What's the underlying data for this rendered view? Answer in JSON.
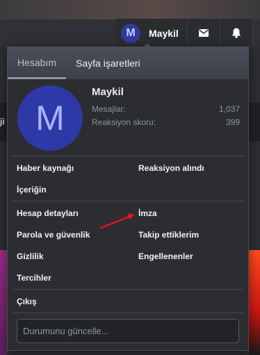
{
  "header": {
    "user_initial": "M",
    "username": "Maykil",
    "mail_icon": "envelope-icon",
    "bell_icon": "bell-icon"
  },
  "background": {
    "strip_text": "ji"
  },
  "dropdown": {
    "tabs": [
      {
        "label": "Hesabım",
        "active": true
      },
      {
        "label": "Sayfa işaretleri",
        "active": false
      }
    ],
    "profile": {
      "initial": "M",
      "name": "Maykil",
      "stats": [
        {
          "label": "Mesajlar:",
          "value": "1,037"
        },
        {
          "label": "Reaksiyon skoru:",
          "value": "399"
        }
      ]
    },
    "menu_groups": [
      [
        {
          "label": "Haber kaynağı"
        },
        {
          "label": "Reaksiyon alındı"
        },
        {
          "label": "İçeriğin"
        },
        {
          "label": ""
        }
      ],
      [
        {
          "label": "Hesap detayları"
        },
        {
          "label": "İmza"
        },
        {
          "label": "Parola ve güvenlik"
        },
        {
          "label": "Takip ettiklerim"
        },
        {
          "label": "Gizlilik"
        },
        {
          "label": "Engellenenler"
        },
        {
          "label": "Tercihler"
        },
        {
          "label": ""
        }
      ],
      [
        {
          "label": "Çıkış"
        }
      ]
    ],
    "status": {
      "placeholder": "Durumunu güncelle..."
    }
  },
  "colors": {
    "accent": "#2d39a6",
    "arrow": "#e0161c"
  }
}
